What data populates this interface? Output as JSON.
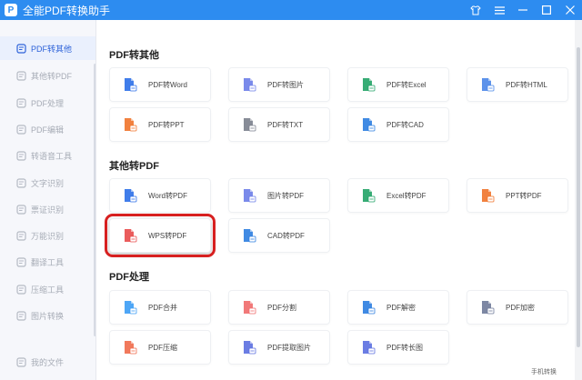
{
  "titlebar": {
    "app_title": "全能PDF转换助手",
    "logo_glyph": "P",
    "controls": [
      "shirt-icon",
      "menu-icon",
      "minimize-icon",
      "maximize-icon",
      "close-icon"
    ]
  },
  "sidebar": {
    "items": [
      {
        "label": "PDF转其他",
        "icon": "pdf-file-icon",
        "active": true
      },
      {
        "label": "其他转PDF",
        "icon": "file-convert-icon",
        "active": false
      },
      {
        "label": "PDF处理",
        "icon": "pdf-process-icon",
        "active": false
      },
      {
        "label": "PDF编辑",
        "icon": "edit-icon",
        "active": false
      },
      {
        "label": "转语音工具",
        "icon": "voice-icon",
        "active": false
      },
      {
        "label": "文字识别",
        "icon": "text-ocr-icon",
        "active": false
      },
      {
        "label": "票证识别",
        "icon": "ticket-icon",
        "active": false
      },
      {
        "label": "万能识别",
        "icon": "scan-icon",
        "active": false
      },
      {
        "label": "翻译工具",
        "icon": "translate-icon",
        "active": false
      },
      {
        "label": "压缩工具",
        "icon": "compress-icon",
        "active": false
      },
      {
        "label": "图片转换",
        "icon": "image-icon",
        "active": false
      },
      {
        "label": "我的文件",
        "icon": "folder-icon",
        "active": false
      }
    ]
  },
  "sections": [
    {
      "title": "PDF转其他",
      "cards": [
        {
          "label": "PDF转Word",
          "icon": "pdf-to-word-icon",
          "color": "#2b6fe8"
        },
        {
          "label": "PDF转图片",
          "icon": "pdf-to-image-icon",
          "color": "#6b7de8"
        },
        {
          "label": "PDF转Excel",
          "icon": "pdf-to-excel-icon",
          "color": "#21a366"
        },
        {
          "label": "PDF转HTML",
          "icon": "pdf-to-html-icon",
          "color": "#4a86e8"
        },
        {
          "label": "PDF转PPT",
          "icon": "pdf-to-ppt-icon",
          "color": "#f0732a"
        },
        {
          "label": "PDF转TXT",
          "icon": "pdf-to-txt-icon",
          "color": "#7a7f8c"
        },
        {
          "label": "PDF转CAD",
          "icon": "pdf-to-cad-icon",
          "color": "#2b7de0"
        }
      ]
    },
    {
      "title": "其他转PDF",
      "cards": [
        {
          "label": "Word转PDF",
          "icon": "word-to-pdf-icon",
          "color": "#2b6fe8"
        },
        {
          "label": "图片转PDF",
          "icon": "image-to-pdf-icon",
          "color": "#6b7de8"
        },
        {
          "label": "Excel转PDF",
          "icon": "excel-to-pdf-icon",
          "color": "#21a366"
        },
        {
          "label": "PPT转PDF",
          "icon": "ppt-to-pdf-icon",
          "color": "#f0732a"
        },
        {
          "label": "WPS转PDF",
          "icon": "wps-to-pdf-icon",
          "color": "#e84a4a",
          "highlight": true
        },
        {
          "label": "CAD转PDF",
          "icon": "cad-to-pdf-icon",
          "color": "#2b7de0"
        }
      ]
    },
    {
      "title": "PDF处理",
      "cards": [
        {
          "label": "PDF合并",
          "icon": "pdf-merge-icon",
          "color": "#3b9cf5"
        },
        {
          "label": "PDF分割",
          "icon": "pdf-split-icon",
          "color": "#f06a6a"
        },
        {
          "label": "PDF解密",
          "icon": "pdf-decrypt-icon",
          "color": "#2b7de0"
        },
        {
          "label": "PDF加密",
          "icon": "pdf-encrypt-icon",
          "color": "#6f7a99"
        },
        {
          "label": "PDF压缩",
          "icon": "pdf-compress-icon",
          "color": "#f06a4a"
        },
        {
          "label": "PDF提取图片",
          "icon": "pdf-extract-image-icon",
          "color": "#5b6fe0"
        },
        {
          "label": "PDF转长图",
          "icon": "pdf-long-image-icon",
          "color": "#5b6fe0"
        }
      ]
    }
  ],
  "footer": {
    "text": "手机转换"
  }
}
